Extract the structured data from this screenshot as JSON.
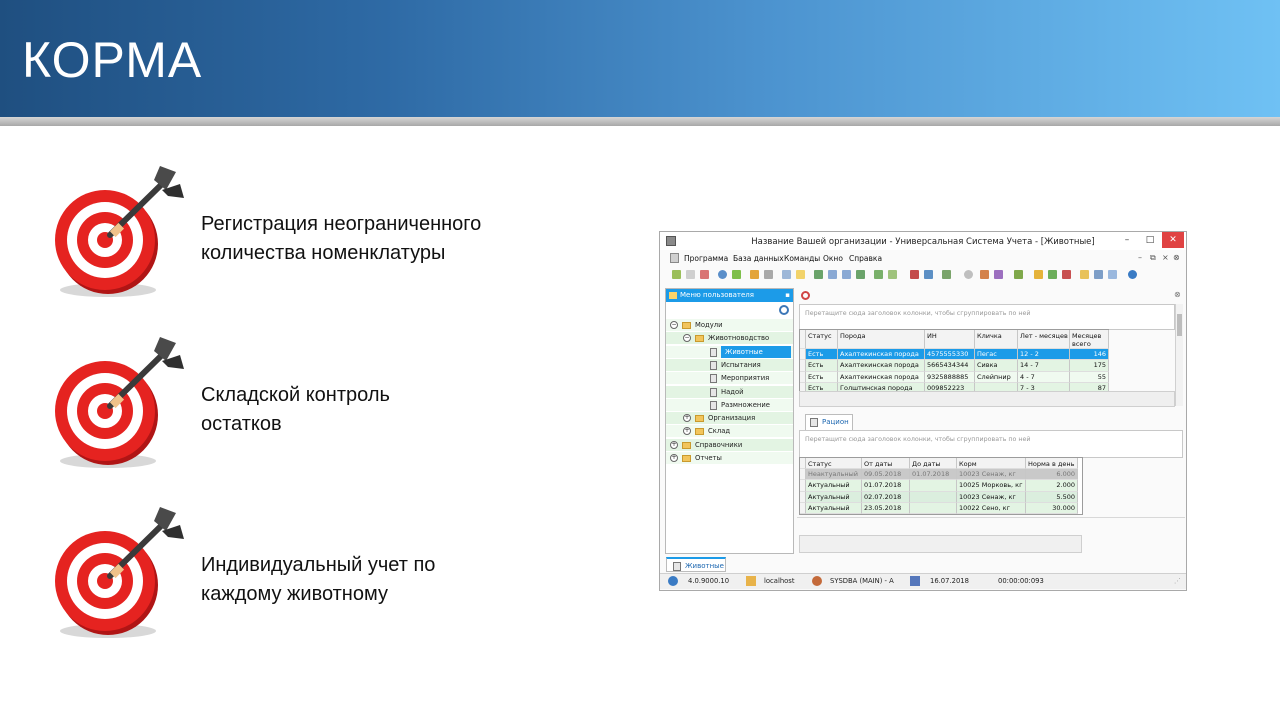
{
  "slide": {
    "title": "КОРМА",
    "bullets": [
      {
        "text": "Регистрация неограниченного\nколичества номенклатуры",
        "icon": "target-icon"
      },
      {
        "text": "Складской контроль\nостатков",
        "icon": "target-icon"
      },
      {
        "text": "Индивидуальный учет по\nкаждому животному",
        "icon": "target-icon"
      }
    ]
  },
  "app": {
    "title": "Название Вашей организации - Универсальная Система Учета - [Животные]",
    "window_buttons": [
      "–",
      "□",
      "✕"
    ],
    "menu": [
      "Программа",
      "База данных",
      "Команды",
      "Окно",
      "Справка"
    ],
    "menu_right": [
      "–",
      "⧉",
      "×",
      "⊗"
    ],
    "left_panel": {
      "header": "Меню пользователя",
      "tree": [
        {
          "label": "Модули",
          "level": 0,
          "type": "folder",
          "expander": "−"
        },
        {
          "label": "Животноводство",
          "level": 1,
          "type": "folder",
          "expander": "−"
        },
        {
          "label": "Животные",
          "level": 2,
          "type": "doc",
          "selected": true
        },
        {
          "label": "Испытания",
          "level": 2,
          "type": "doc"
        },
        {
          "label": "Мероприятия",
          "level": 2,
          "type": "doc"
        },
        {
          "label": "Надой",
          "level": 2,
          "type": "doc"
        },
        {
          "label": "Размножение",
          "level": 2,
          "type": "doc"
        },
        {
          "label": "Организация",
          "level": 1,
          "type": "folder",
          "expander": "+"
        },
        {
          "label": "Склад",
          "level": 1,
          "type": "folder",
          "expander": "+"
        },
        {
          "label": "Справочники",
          "level": 0,
          "type": "folder",
          "expander": "+"
        },
        {
          "label": "Отчеты",
          "level": 0,
          "type": "folder",
          "expander": "+"
        }
      ]
    },
    "group_hint": "Перетащите сюда заголовок колонки, чтобы сгруппировать по ней",
    "animals_grid": {
      "columns": [
        "Статус",
        "Порода",
        "ИН",
        "Кличка",
        "Лет - месяцев",
        "Месяцев\nвсего"
      ],
      "rows": [
        [
          "Есть",
          "Ахалтекинская порода",
          "4575555330",
          "Пегас",
          "12 - 2",
          "146"
        ],
        [
          "Есть",
          "Ахалтекинская порода",
          "5665434344",
          "Сивка",
          "14 - 7",
          "175"
        ],
        [
          "Есть",
          "Ахалтекинская порода",
          "9325888885",
          "Слейпнир",
          "4 - 7",
          "55"
        ],
        [
          "Есть",
          "Голштинская порода",
          "009852223",
          "",
          "7 - 3",
          "87"
        ]
      ]
    },
    "ration_tab": "Рацион",
    "ration_grid": {
      "columns": [
        "Статус",
        "От даты",
        "До даты",
        "Корм",
        "Норма в день"
      ],
      "rows": [
        [
          "Неактуальный",
          "09.05.2018",
          "01.07.2018",
          "10023 Сенаж, кг",
          "6.000"
        ],
        [
          "Актуальный",
          "01.07.2018",
          "",
          "10025 Морковь, кг",
          "2.000"
        ],
        [
          "Актуальный",
          "02.07.2018",
          "",
          "10023 Сенаж, кг",
          "5.500"
        ],
        [
          "Актуальный",
          "23.05.2018",
          "",
          "10022 Сено, кг",
          "30.000"
        ]
      ]
    },
    "bottom_tab": "Животные",
    "status": {
      "version": "4.0.9000.10",
      "server": "localhost",
      "user": "SYSDBA (MAIN) - A",
      "date": "16.07.2018",
      "timer": "00:00:00:093"
    },
    "colors": {
      "selection": "#1c9be8",
      "row_alt": "#e3f4e3",
      "row_light": "#f0faf0",
      "inactive_row": "#c9c9c9"
    }
  }
}
